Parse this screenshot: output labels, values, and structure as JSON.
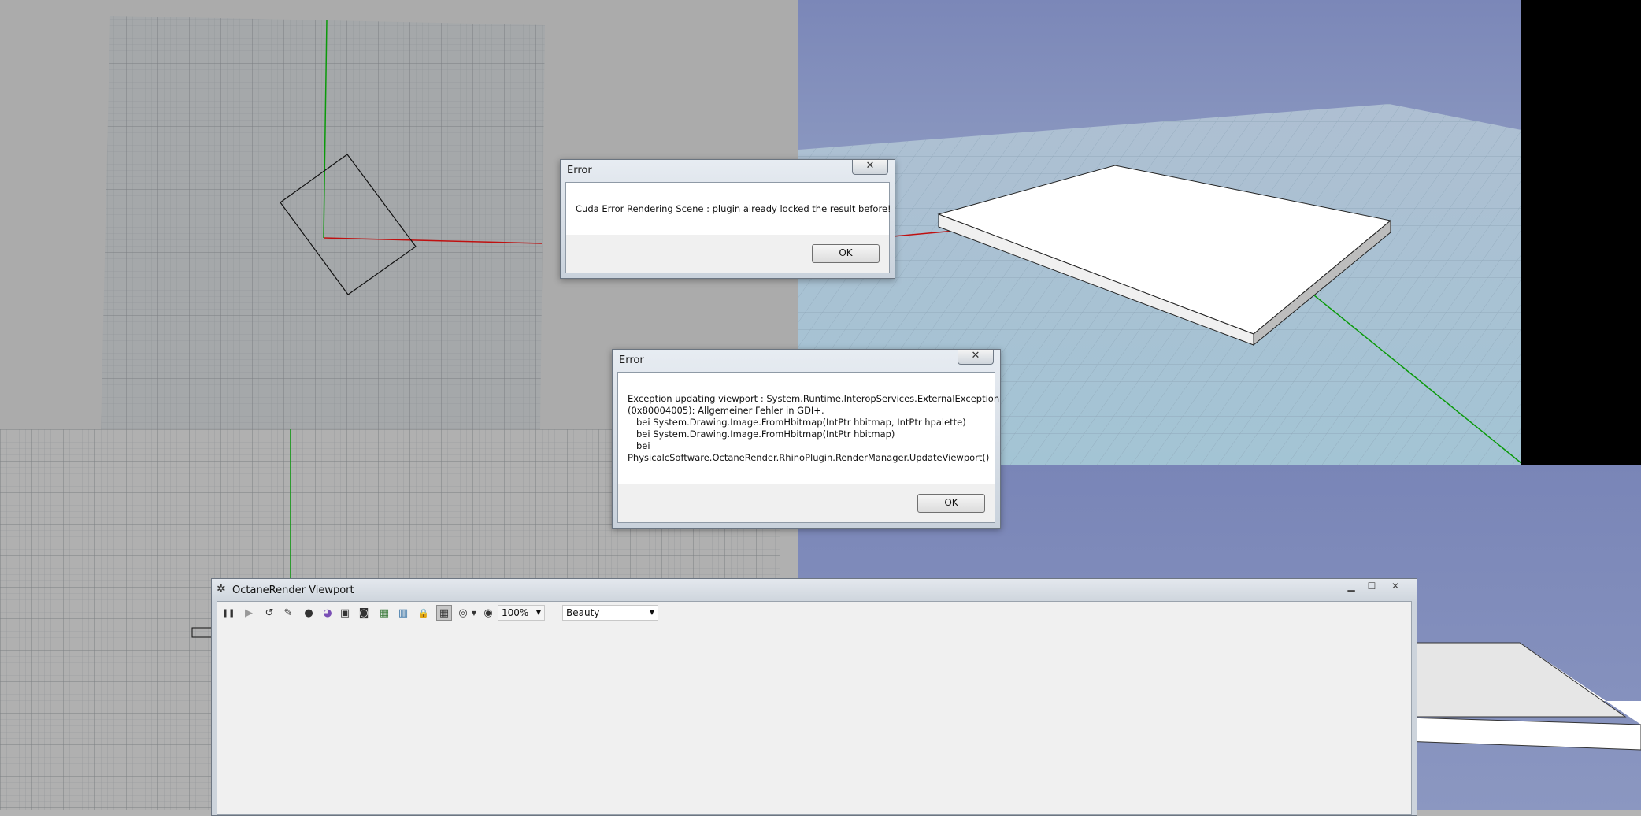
{
  "dialogs": {
    "cuda_error": {
      "title": "Error",
      "close": "✕",
      "message": "Cuda Error Rendering Scene : plugin already locked the result before!",
      "ok_label": "OK"
    },
    "viewport_error": {
      "title": "Error",
      "close": "✕",
      "message_lines": [
        "Exception updating viewport : System.Runtime.InteropServices.ExternalException",
        "(0x80004005): Allgemeiner Fehler in GDI+.",
        "   bei System.Drawing.Image.FromHbitmap(IntPtr hbitmap, IntPtr hpalette)",
        "   bei System.Drawing.Image.FromHbitmap(IntPtr hbitmap)",
        "   bei",
        "PhysicalcSoftware.OctaneRender.RhinoPlugin.RenderManager.UpdateViewport()"
      ],
      "ok_label": "OK"
    }
  },
  "octane_window": {
    "title": "OctaneRender Viewport",
    "window_buttons": {
      "minimize": "▁",
      "maximize": "☐",
      "close": "✕"
    },
    "toolbar": {
      "icons": [
        "pause-icon",
        "play-icon",
        "reset-icon",
        "render-settings-icon",
        "camera-icon",
        "material-icon",
        "object-icon",
        "snapshot-icon",
        "region-icon",
        "film-icon",
        "lock-icon",
        "viewport-grid-icon",
        "focus-icon",
        "zoom-icon"
      ],
      "glyphs": [
        "❚❚",
        "▶",
        "↺",
        "✎",
        "●",
        "◕",
        "▣",
        "◙",
        "▦",
        "▥",
        "🔒",
        "▦",
        "◎",
        "◉"
      ],
      "zoom_value": "100%",
      "render_pass_value": "Beauty"
    }
  },
  "colors": {
    "x_axis": "#c00000",
    "y_axis": "#00a000",
    "sky_top": "#7f8bb9",
    "sky_horizon": "#a8b8cf",
    "ground": "#a9c6d6"
  }
}
